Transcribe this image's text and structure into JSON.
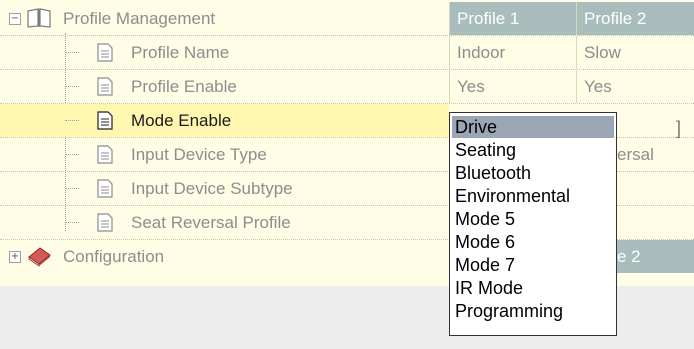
{
  "tree": {
    "root_label": "Profile Management",
    "children": [
      "Profile Name",
      "Profile Enable",
      "Mode Enable",
      "Input Device Type",
      "Input Device Subtype",
      "Seat Reversal Profile"
    ],
    "config_label": "Configuration"
  },
  "columns": {
    "profile1_header": "Profile 1",
    "profile2_header": "Profile 2"
  },
  "values": {
    "profile_name": [
      "Indoor",
      "Slow"
    ],
    "profile_enable": [
      "Yes",
      "Yes"
    ],
    "input_device_type_p2_partial": "ersal",
    "config_p2_partial": "e 2",
    "mode_enable_bracket": "]"
  },
  "dropdown": {
    "options": [
      "Drive",
      "Seating",
      "Bluetooth",
      "Environmental",
      "Mode 5",
      "Mode 6",
      "Mode 7",
      "IR Mode",
      "Programming"
    ],
    "selected_index": 0
  },
  "colors": {
    "header_bg": "#a9bdbd",
    "grid_bg": "#fffde6",
    "selected_row": "#fff7b0",
    "dropdown_selection": "#9aa6b3"
  }
}
